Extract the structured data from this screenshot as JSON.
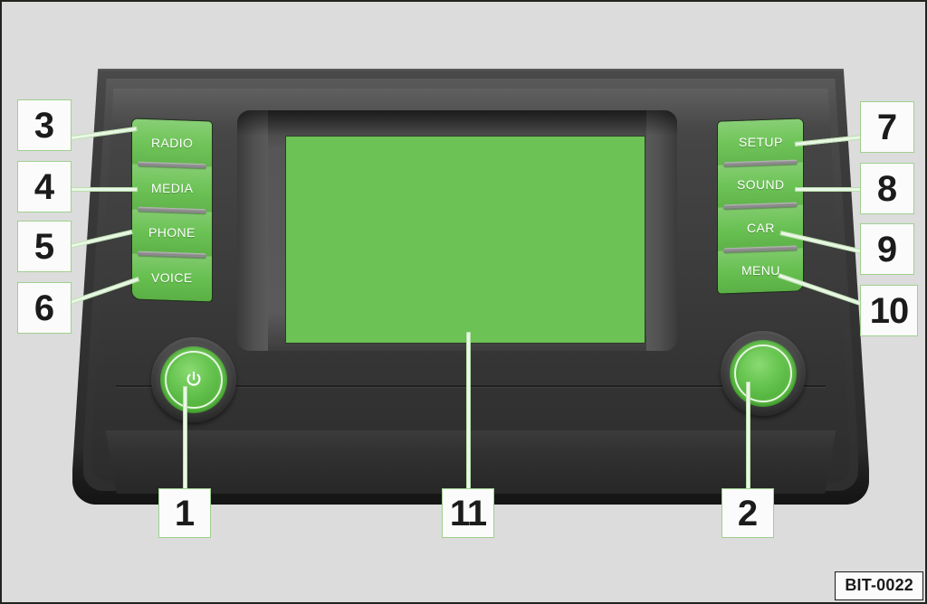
{
  "figure": {
    "code": "BIT-0022",
    "background_color": "#dcdcdc",
    "accent_green": "#6cc255",
    "callout_border_color": "#9fd08f"
  },
  "device": {
    "name": "car-infotainment-head-unit",
    "display": {
      "label": "display-screen",
      "color": "#6cc255"
    },
    "left_buttons": [
      {
        "label": "RADIO",
        "callout": "3"
      },
      {
        "label": "MEDIA",
        "callout": "4"
      },
      {
        "label": "PHONE",
        "callout": "5"
      },
      {
        "label": "VOICE",
        "callout": "6"
      }
    ],
    "right_buttons": [
      {
        "label": "SETUP",
        "callout": "7"
      },
      {
        "label": "SOUND",
        "callout": "8"
      },
      {
        "label": "CAR",
        "callout": "9"
      },
      {
        "label": "MENU",
        "callout": "10"
      }
    ],
    "knobs": [
      {
        "name": "power-volume-knob",
        "icon": "power-icon",
        "callout": "1"
      },
      {
        "name": "tuning-selector-knob",
        "icon": "knob-icon",
        "callout": "2"
      }
    ]
  },
  "callouts": {
    "c1": "1",
    "c2": "2",
    "c3": "3",
    "c4": "4",
    "c5": "5",
    "c6": "6",
    "c7": "7",
    "c8": "8",
    "c9": "9",
    "c10": "10",
    "c11": "11"
  }
}
